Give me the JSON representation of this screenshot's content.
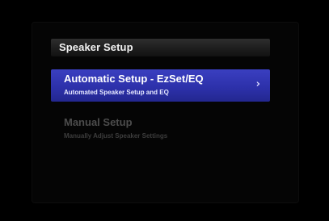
{
  "menu": {
    "title": "Speaker Setup",
    "items": [
      {
        "label": "Automatic Setup - EzSet/EQ",
        "description": "Automated Speaker Setup and EQ",
        "selected": true,
        "icon": "chevron-right-icon",
        "icon_glyph": "›"
      },
      {
        "label": "Manual Setup",
        "description": "Manually Adjust Speaker Settings",
        "selected": false
      }
    ]
  },
  "colors": {
    "background": "#000000",
    "highlight": "#2d31ab",
    "text_active": "#ffffff",
    "text_inactive": "#4c4c4c"
  }
}
